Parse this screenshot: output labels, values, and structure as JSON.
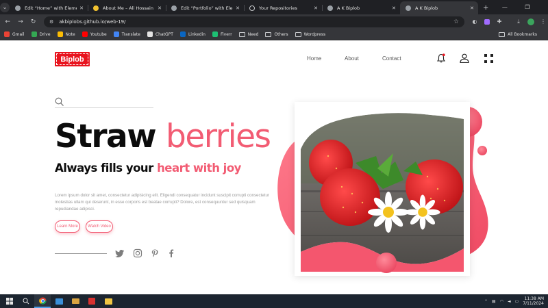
{
  "browser": {
    "tabs": [
      {
        "title": "Edit “Home” with Elementor",
        "favicon_color": "#9aa0a6",
        "active": false
      },
      {
        "title": "About Me – Ali Hossain",
        "favicon_color": "#f2c230",
        "active": false
      },
      {
        "title": "Edit “Portfolio” with Elemen",
        "favicon_color": "#9aa0a6",
        "active": false
      },
      {
        "title": "Your Repositories",
        "favicon_color": "#1f2024",
        "active": false
      },
      {
        "title": "A K Biplob",
        "favicon_color": "#9aa0a6",
        "active": false
      },
      {
        "title": "A K Biplob",
        "favicon_color": "#9aa0a6",
        "active": true
      }
    ],
    "url": "akbiplobs.github.io/web-19/",
    "bookmarks": [
      {
        "label": "Gmail",
        "color": "#ea4335",
        "icon": "gmail-icon"
      },
      {
        "label": "Drive",
        "color": "#34a853",
        "icon": "drive-icon"
      },
      {
        "label": "Note",
        "color": "#fbbc04",
        "icon": "note-icon"
      },
      {
        "label": "Youtube",
        "color": "#ff0000",
        "icon": "youtube-icon"
      },
      {
        "label": "Translate",
        "color": "#4285f4",
        "icon": "translate-icon"
      },
      {
        "label": "ChatGPT",
        "color": "#e3e3e3",
        "icon": "chatgpt-icon"
      },
      {
        "label": "Linkedin",
        "color": "#0a66c2",
        "icon": "linkedin-icon"
      },
      {
        "label": "Fiverr",
        "color": "#1dbf73",
        "icon": "fiverr-icon"
      },
      {
        "label": "Need",
        "color": "",
        "icon": "folder-icon"
      },
      {
        "label": "Others",
        "color": "",
        "icon": "folder-icon"
      },
      {
        "label": "Wordpress",
        "color": "",
        "icon": "folder-icon"
      }
    ],
    "all_bookmarks": "All Bookmarks"
  },
  "site": {
    "logo": "Biplob",
    "nav": {
      "home": "Home",
      "about": "About",
      "contact": "Contact"
    },
    "search_placeholder": "",
    "headline_dark": "Straw ",
    "headline_pink": "berries",
    "subhead_dark": "Always fills your ",
    "subhead_pink": "heart with joy",
    "lorem": "Lorem ipsum dolor sit amet, consectetur adipisicing elit. Eligendi consequatur incidunt suscipit corrupti consectetur molestias ullam qui deserunt, in esse corporis est beatae corrupti? Dolore, est consequuntur sed quisquam repudiandae adipisci.",
    "learn_more": "Learn More",
    "watch_video": "Watch Video",
    "social": [
      "twitter-icon",
      "instagram-icon",
      "pinterest-icon",
      "facebook-icon"
    ],
    "accent": "#f25c73"
  },
  "taskbar": {
    "time": "11:38 AM",
    "date": "7/11/2024"
  }
}
